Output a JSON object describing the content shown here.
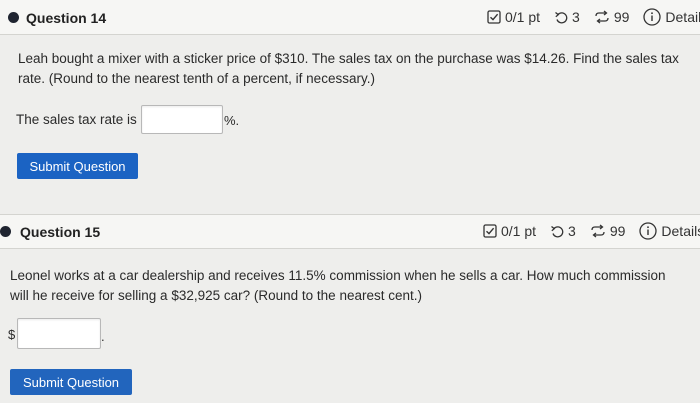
{
  "q14": {
    "title": "Question 14",
    "score": "0/1 pt",
    "retries": "3",
    "attempts": "99",
    "details": "Details",
    "prompt_line1": "Leah bought a mixer with a sticker price of $310. The sales tax on the purchase was $14.26. Find the sales tax",
    "prompt_line2": "rate. (Round to the nearest tenth of a percent, if necessary.)",
    "answer_label": "The sales tax rate is",
    "answer_value": "",
    "answer_suffix": "%.",
    "submit_label": "Submit Question"
  },
  "q15": {
    "title": "Question 15",
    "score": "0/1 pt",
    "retries": "3",
    "attempts": "99",
    "details": "Details",
    "prompt_line1": "Leonel works at a car dealership and receives 11.5% commission when he sells a car. How much commission",
    "prompt_line2": "will he receive for selling a $32,925 car? (Round to the nearest cent.)",
    "answer_prefix": "$",
    "answer_value": "",
    "answer_suffix": ".",
    "submit_label": "Submit Question"
  },
  "icons": {
    "score": "checkbox-icon",
    "retries": "undo-icon",
    "attempts": "repeat-icon",
    "details": "info-icon"
  },
  "colors": {
    "submit_button": "#1b63c3",
    "bullet": "#1f2430"
  }
}
